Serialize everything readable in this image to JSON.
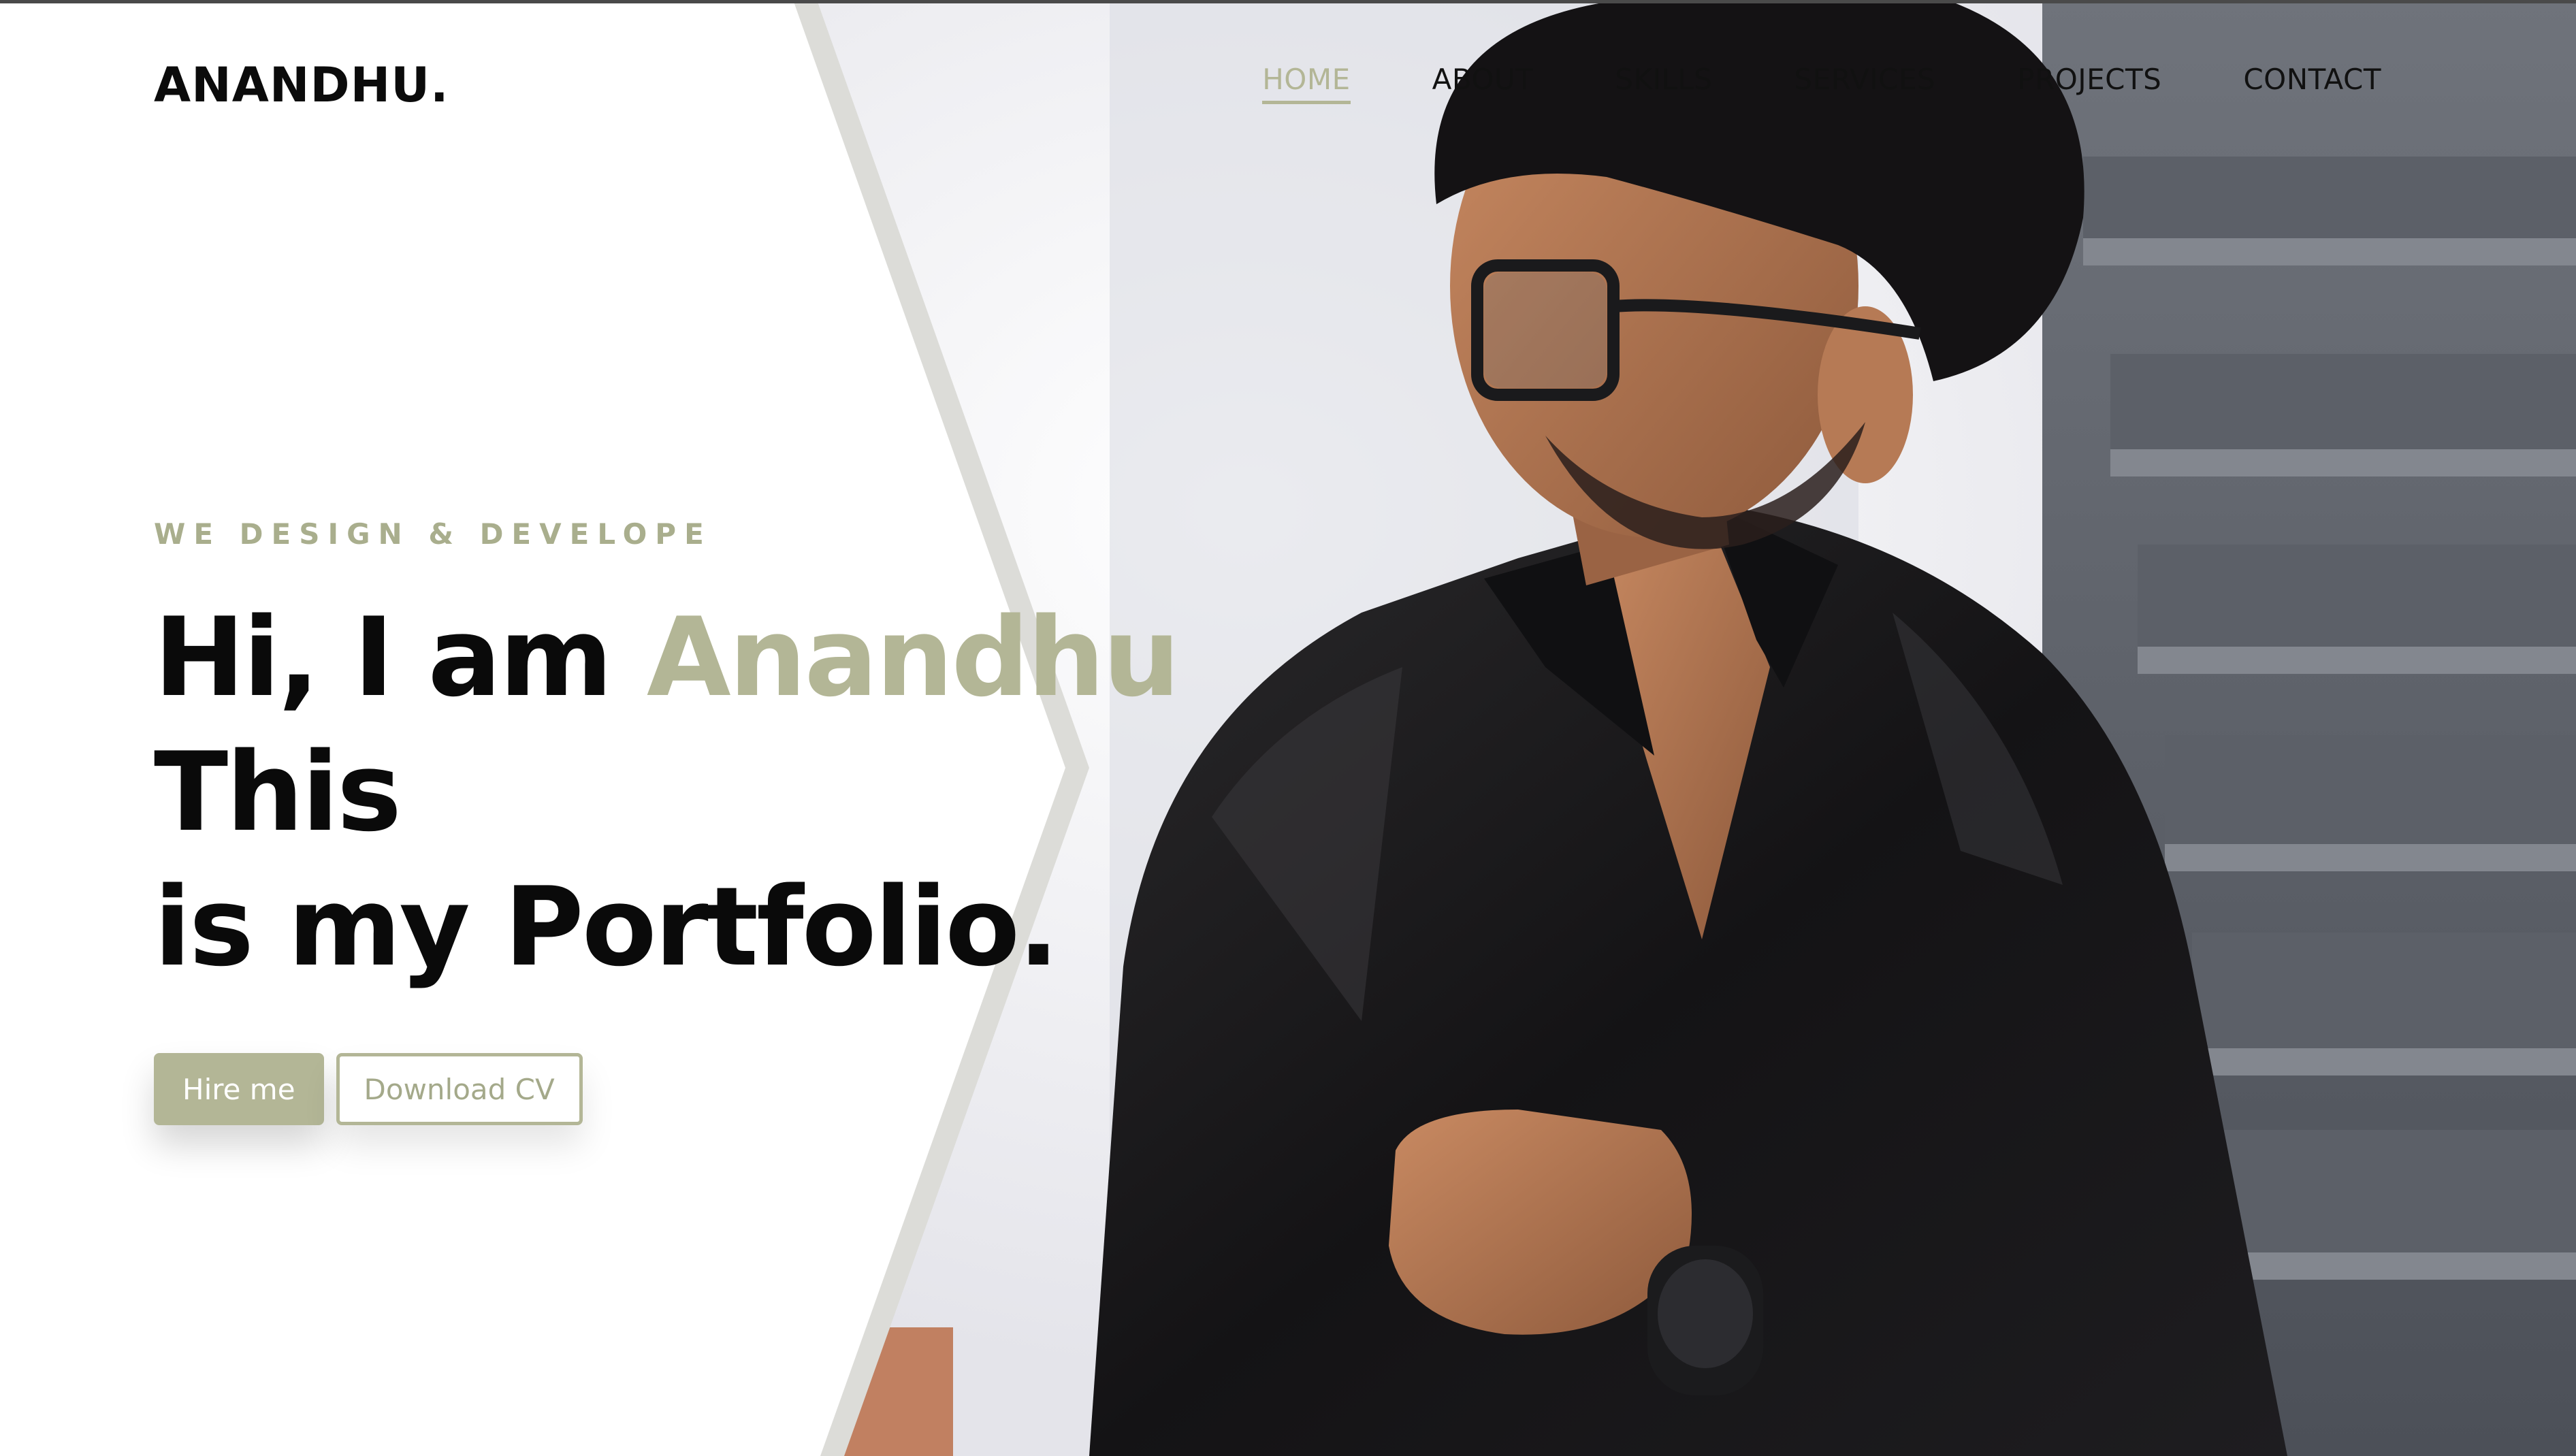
{
  "brand": {
    "name": "ANANDHU."
  },
  "nav": {
    "items": [
      {
        "label": "HOME",
        "active": true
      },
      {
        "label": "ABOUT",
        "active": false
      },
      {
        "label": "SKILLS",
        "active": false
      },
      {
        "label": "SERVICES",
        "active": false
      },
      {
        "label": "PROJECTS",
        "active": false
      },
      {
        "label": "CONTACT",
        "active": false
      }
    ]
  },
  "hero": {
    "eyebrow": "WE DESIGN & DEVELOPE",
    "title_part1": "Hi, I am ",
    "title_name": "Anandhu",
    "title_part2": " This",
    "title_line2": "is my Portfolio.",
    "primary_button": "Hire me",
    "secondary_button": "Download CV",
    "photo": "portrait-man-black-shirt-glasses"
  },
  "colors": {
    "accent": "#b3b696",
    "text": "#0a0a0a",
    "background": "#ffffff"
  }
}
